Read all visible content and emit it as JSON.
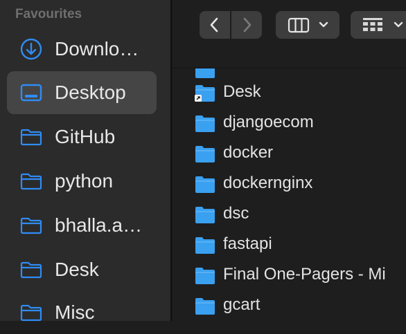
{
  "sidebar": {
    "heading": "Favourites",
    "items": [
      {
        "label": "Downlo…",
        "icon": "download-icon"
      },
      {
        "label": "Desktop",
        "icon": "desktop-icon"
      },
      {
        "label": "GitHub",
        "icon": "folder-icon"
      },
      {
        "label": "python",
        "icon": "folder-icon"
      },
      {
        "label": "bhalla.a…",
        "icon": "folder-icon"
      },
      {
        "label": "Desk",
        "icon": "folder-icon"
      },
      {
        "label": "Misc",
        "icon": "folder-icon"
      }
    ],
    "selected_index": 1
  },
  "toolbar": {
    "back_icon": "chevron-left-icon",
    "forward_icon": "chevron-right-icon",
    "view_icon": "columns-view-icon",
    "group_icon": "grid-group-icon"
  },
  "files": [
    {
      "label": "Desk",
      "alias": true
    },
    {
      "label": "djangoecom"
    },
    {
      "label": "docker"
    },
    {
      "label": "dockernginx"
    },
    {
      "label": "dsc"
    },
    {
      "label": "fastapi"
    },
    {
      "label": "Final One-Pagers - Mi"
    },
    {
      "label": "gcart"
    }
  ],
  "colors": {
    "accent": "#2f8cf5",
    "folder": "#3aa0f0",
    "sidebar_bg": "#2b2b2b",
    "content_bg": "#1e1e1e",
    "selected_bg": "#454545"
  }
}
